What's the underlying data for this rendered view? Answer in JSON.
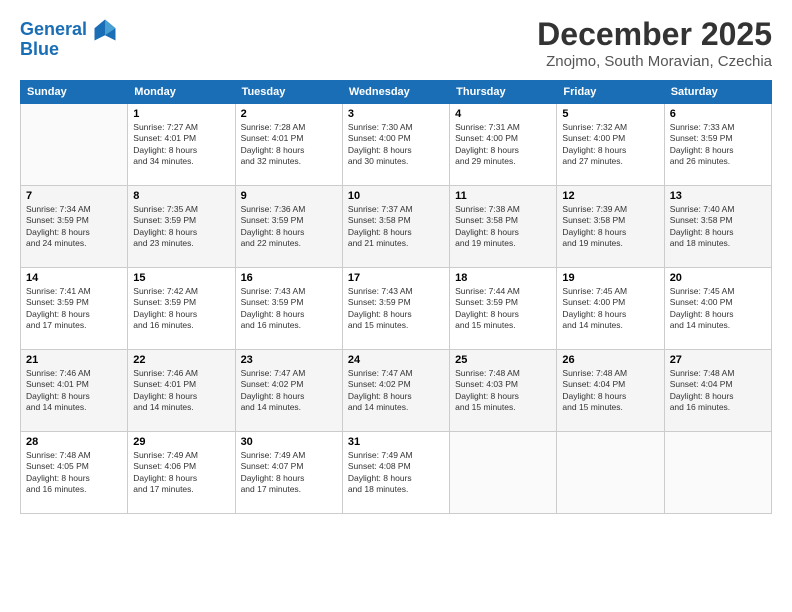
{
  "logo": {
    "line1": "General",
    "line2": "Blue"
  },
  "title": "December 2025",
  "subtitle": "Znojmo, South Moravian, Czechia",
  "days_of_week": [
    "Sunday",
    "Monday",
    "Tuesday",
    "Wednesday",
    "Thursday",
    "Friday",
    "Saturday"
  ],
  "weeks": [
    [
      {
        "num": "",
        "info": ""
      },
      {
        "num": "1",
        "info": "Sunrise: 7:27 AM\nSunset: 4:01 PM\nDaylight: 8 hours\nand 34 minutes."
      },
      {
        "num": "2",
        "info": "Sunrise: 7:28 AM\nSunset: 4:01 PM\nDaylight: 8 hours\nand 32 minutes."
      },
      {
        "num": "3",
        "info": "Sunrise: 7:30 AM\nSunset: 4:00 PM\nDaylight: 8 hours\nand 30 minutes."
      },
      {
        "num": "4",
        "info": "Sunrise: 7:31 AM\nSunset: 4:00 PM\nDaylight: 8 hours\nand 29 minutes."
      },
      {
        "num": "5",
        "info": "Sunrise: 7:32 AM\nSunset: 4:00 PM\nDaylight: 8 hours\nand 27 minutes."
      },
      {
        "num": "6",
        "info": "Sunrise: 7:33 AM\nSunset: 3:59 PM\nDaylight: 8 hours\nand 26 minutes."
      }
    ],
    [
      {
        "num": "7",
        "info": "Sunrise: 7:34 AM\nSunset: 3:59 PM\nDaylight: 8 hours\nand 24 minutes."
      },
      {
        "num": "8",
        "info": "Sunrise: 7:35 AM\nSunset: 3:59 PM\nDaylight: 8 hours\nand 23 minutes."
      },
      {
        "num": "9",
        "info": "Sunrise: 7:36 AM\nSunset: 3:59 PM\nDaylight: 8 hours\nand 22 minutes."
      },
      {
        "num": "10",
        "info": "Sunrise: 7:37 AM\nSunset: 3:58 PM\nDaylight: 8 hours\nand 21 minutes."
      },
      {
        "num": "11",
        "info": "Sunrise: 7:38 AM\nSunset: 3:58 PM\nDaylight: 8 hours\nand 19 minutes."
      },
      {
        "num": "12",
        "info": "Sunrise: 7:39 AM\nSunset: 3:58 PM\nDaylight: 8 hours\nand 19 minutes."
      },
      {
        "num": "13",
        "info": "Sunrise: 7:40 AM\nSunset: 3:58 PM\nDaylight: 8 hours\nand 18 minutes."
      }
    ],
    [
      {
        "num": "14",
        "info": "Sunrise: 7:41 AM\nSunset: 3:59 PM\nDaylight: 8 hours\nand 17 minutes."
      },
      {
        "num": "15",
        "info": "Sunrise: 7:42 AM\nSunset: 3:59 PM\nDaylight: 8 hours\nand 16 minutes."
      },
      {
        "num": "16",
        "info": "Sunrise: 7:43 AM\nSunset: 3:59 PM\nDaylight: 8 hours\nand 16 minutes."
      },
      {
        "num": "17",
        "info": "Sunrise: 7:43 AM\nSunset: 3:59 PM\nDaylight: 8 hours\nand 15 minutes."
      },
      {
        "num": "18",
        "info": "Sunrise: 7:44 AM\nSunset: 3:59 PM\nDaylight: 8 hours\nand 15 minutes."
      },
      {
        "num": "19",
        "info": "Sunrise: 7:45 AM\nSunset: 4:00 PM\nDaylight: 8 hours\nand 14 minutes."
      },
      {
        "num": "20",
        "info": "Sunrise: 7:45 AM\nSunset: 4:00 PM\nDaylight: 8 hours\nand 14 minutes."
      }
    ],
    [
      {
        "num": "21",
        "info": "Sunrise: 7:46 AM\nSunset: 4:01 PM\nDaylight: 8 hours\nand 14 minutes."
      },
      {
        "num": "22",
        "info": "Sunrise: 7:46 AM\nSunset: 4:01 PM\nDaylight: 8 hours\nand 14 minutes."
      },
      {
        "num": "23",
        "info": "Sunrise: 7:47 AM\nSunset: 4:02 PM\nDaylight: 8 hours\nand 14 minutes."
      },
      {
        "num": "24",
        "info": "Sunrise: 7:47 AM\nSunset: 4:02 PM\nDaylight: 8 hours\nand 14 minutes."
      },
      {
        "num": "25",
        "info": "Sunrise: 7:48 AM\nSunset: 4:03 PM\nDaylight: 8 hours\nand 15 minutes."
      },
      {
        "num": "26",
        "info": "Sunrise: 7:48 AM\nSunset: 4:04 PM\nDaylight: 8 hours\nand 15 minutes."
      },
      {
        "num": "27",
        "info": "Sunrise: 7:48 AM\nSunset: 4:04 PM\nDaylight: 8 hours\nand 16 minutes."
      }
    ],
    [
      {
        "num": "28",
        "info": "Sunrise: 7:48 AM\nSunset: 4:05 PM\nDaylight: 8 hours\nand 16 minutes."
      },
      {
        "num": "29",
        "info": "Sunrise: 7:49 AM\nSunset: 4:06 PM\nDaylight: 8 hours\nand 17 minutes."
      },
      {
        "num": "30",
        "info": "Sunrise: 7:49 AM\nSunset: 4:07 PM\nDaylight: 8 hours\nand 17 minutes."
      },
      {
        "num": "31",
        "info": "Sunrise: 7:49 AM\nSunset: 4:08 PM\nDaylight: 8 hours\nand 18 minutes."
      },
      {
        "num": "",
        "info": ""
      },
      {
        "num": "",
        "info": ""
      },
      {
        "num": "",
        "info": ""
      }
    ]
  ]
}
